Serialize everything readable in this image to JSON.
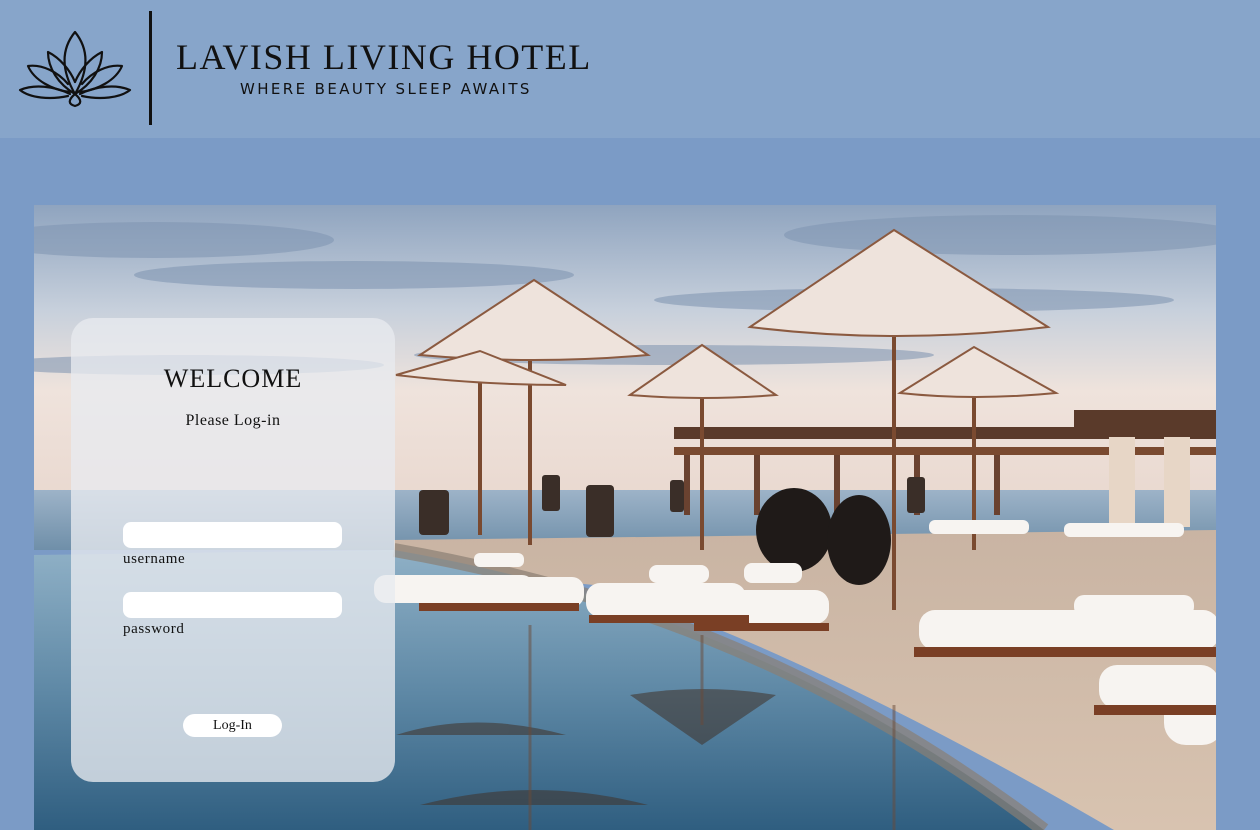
{
  "brand": {
    "title": "LAVISH  LIVING  HOTEL",
    "tagline": "WHERE BEAUTY SLEEP AWAITS",
    "logo_icon": "lotus-icon"
  },
  "login": {
    "welcome": "WELCOME",
    "subtitle": "Please Log-in",
    "username_label": "username",
    "username_value": "",
    "password_label": "password",
    "password_value": "",
    "login_button": "Log-In"
  },
  "colors": {
    "page_background": "#7b9bc6",
    "header_background": "#87a5ca",
    "panel_background": "#e8ebf0"
  }
}
